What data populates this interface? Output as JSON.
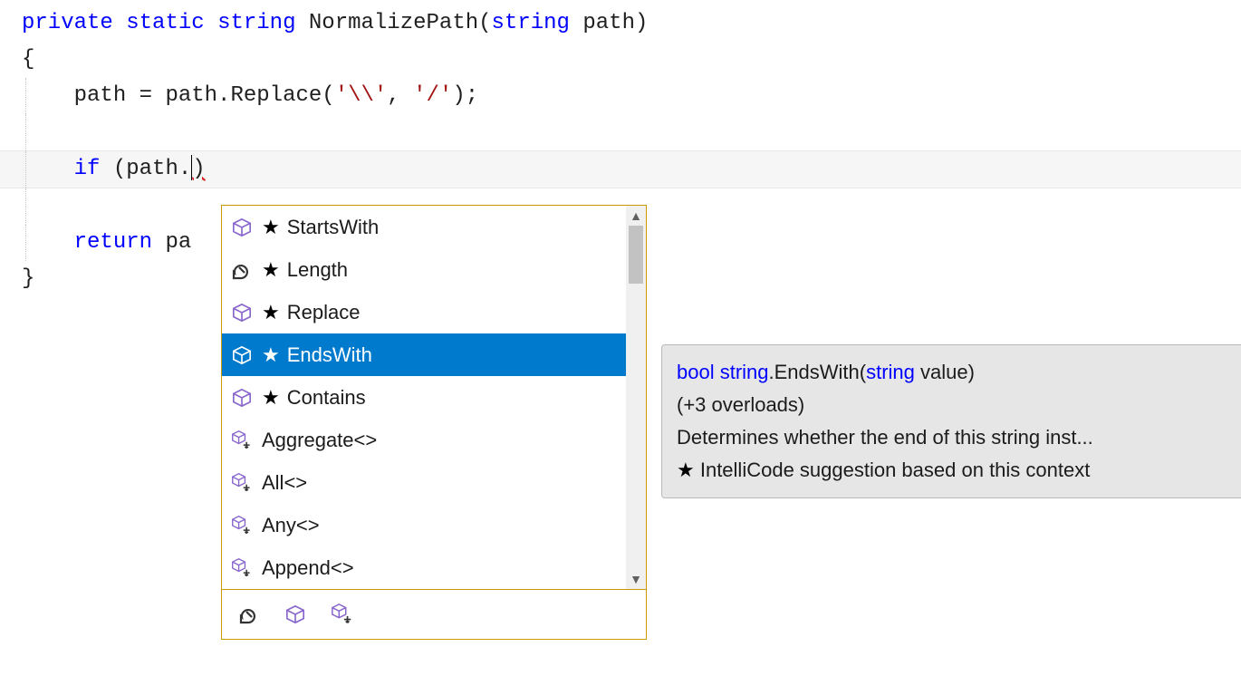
{
  "code": {
    "line1": {
      "kw1": "private",
      "kw2": "static",
      "kw3": "string",
      "method": "NormalizePath",
      "kw4": "string",
      "param": "path"
    },
    "line2": "{",
    "line3": {
      "lhs": "path",
      "op": "=",
      "rhs": "path",
      "call": "Replace",
      "arg1": "'\\\\'",
      "comma": ",",
      "arg2": "'/'"
    },
    "line5": {
      "kw": "if",
      "open": "(",
      "obj": "path",
      "dot": ".",
      "close": ")"
    },
    "line7": {
      "kw": "return",
      "rest": "pa"
    },
    "line8": "}"
  },
  "completion": {
    "items": [
      {
        "icon": "cube",
        "star": true,
        "label": "StartsWith",
        "selected": false
      },
      {
        "icon": "wrench",
        "star": true,
        "label": "Length",
        "selected": false
      },
      {
        "icon": "cube",
        "star": true,
        "label": "Replace",
        "selected": false
      },
      {
        "icon": "cube",
        "star": true,
        "label": "EndsWith",
        "selected": true
      },
      {
        "icon": "cube",
        "star": true,
        "label": "Contains",
        "selected": false
      },
      {
        "icon": "ext",
        "star": false,
        "label": "Aggregate<>",
        "selected": false
      },
      {
        "icon": "ext",
        "star": false,
        "label": "All<>",
        "selected": false
      },
      {
        "icon": "ext",
        "star": false,
        "label": "Any<>",
        "selected": false
      },
      {
        "icon": "ext",
        "star": false,
        "label": "Append<>",
        "selected": false
      }
    ]
  },
  "tooltip": {
    "sig_kw1": "bool",
    "sig_kw2": "string",
    "sig_method": ".EndsWith(",
    "sig_kw3": "string",
    "sig_param": " value)",
    "overloads": "(+3 overloads)",
    "desc": "Determines whether the end of this string inst...",
    "intellicode": " IntelliCode suggestion based on this context"
  }
}
